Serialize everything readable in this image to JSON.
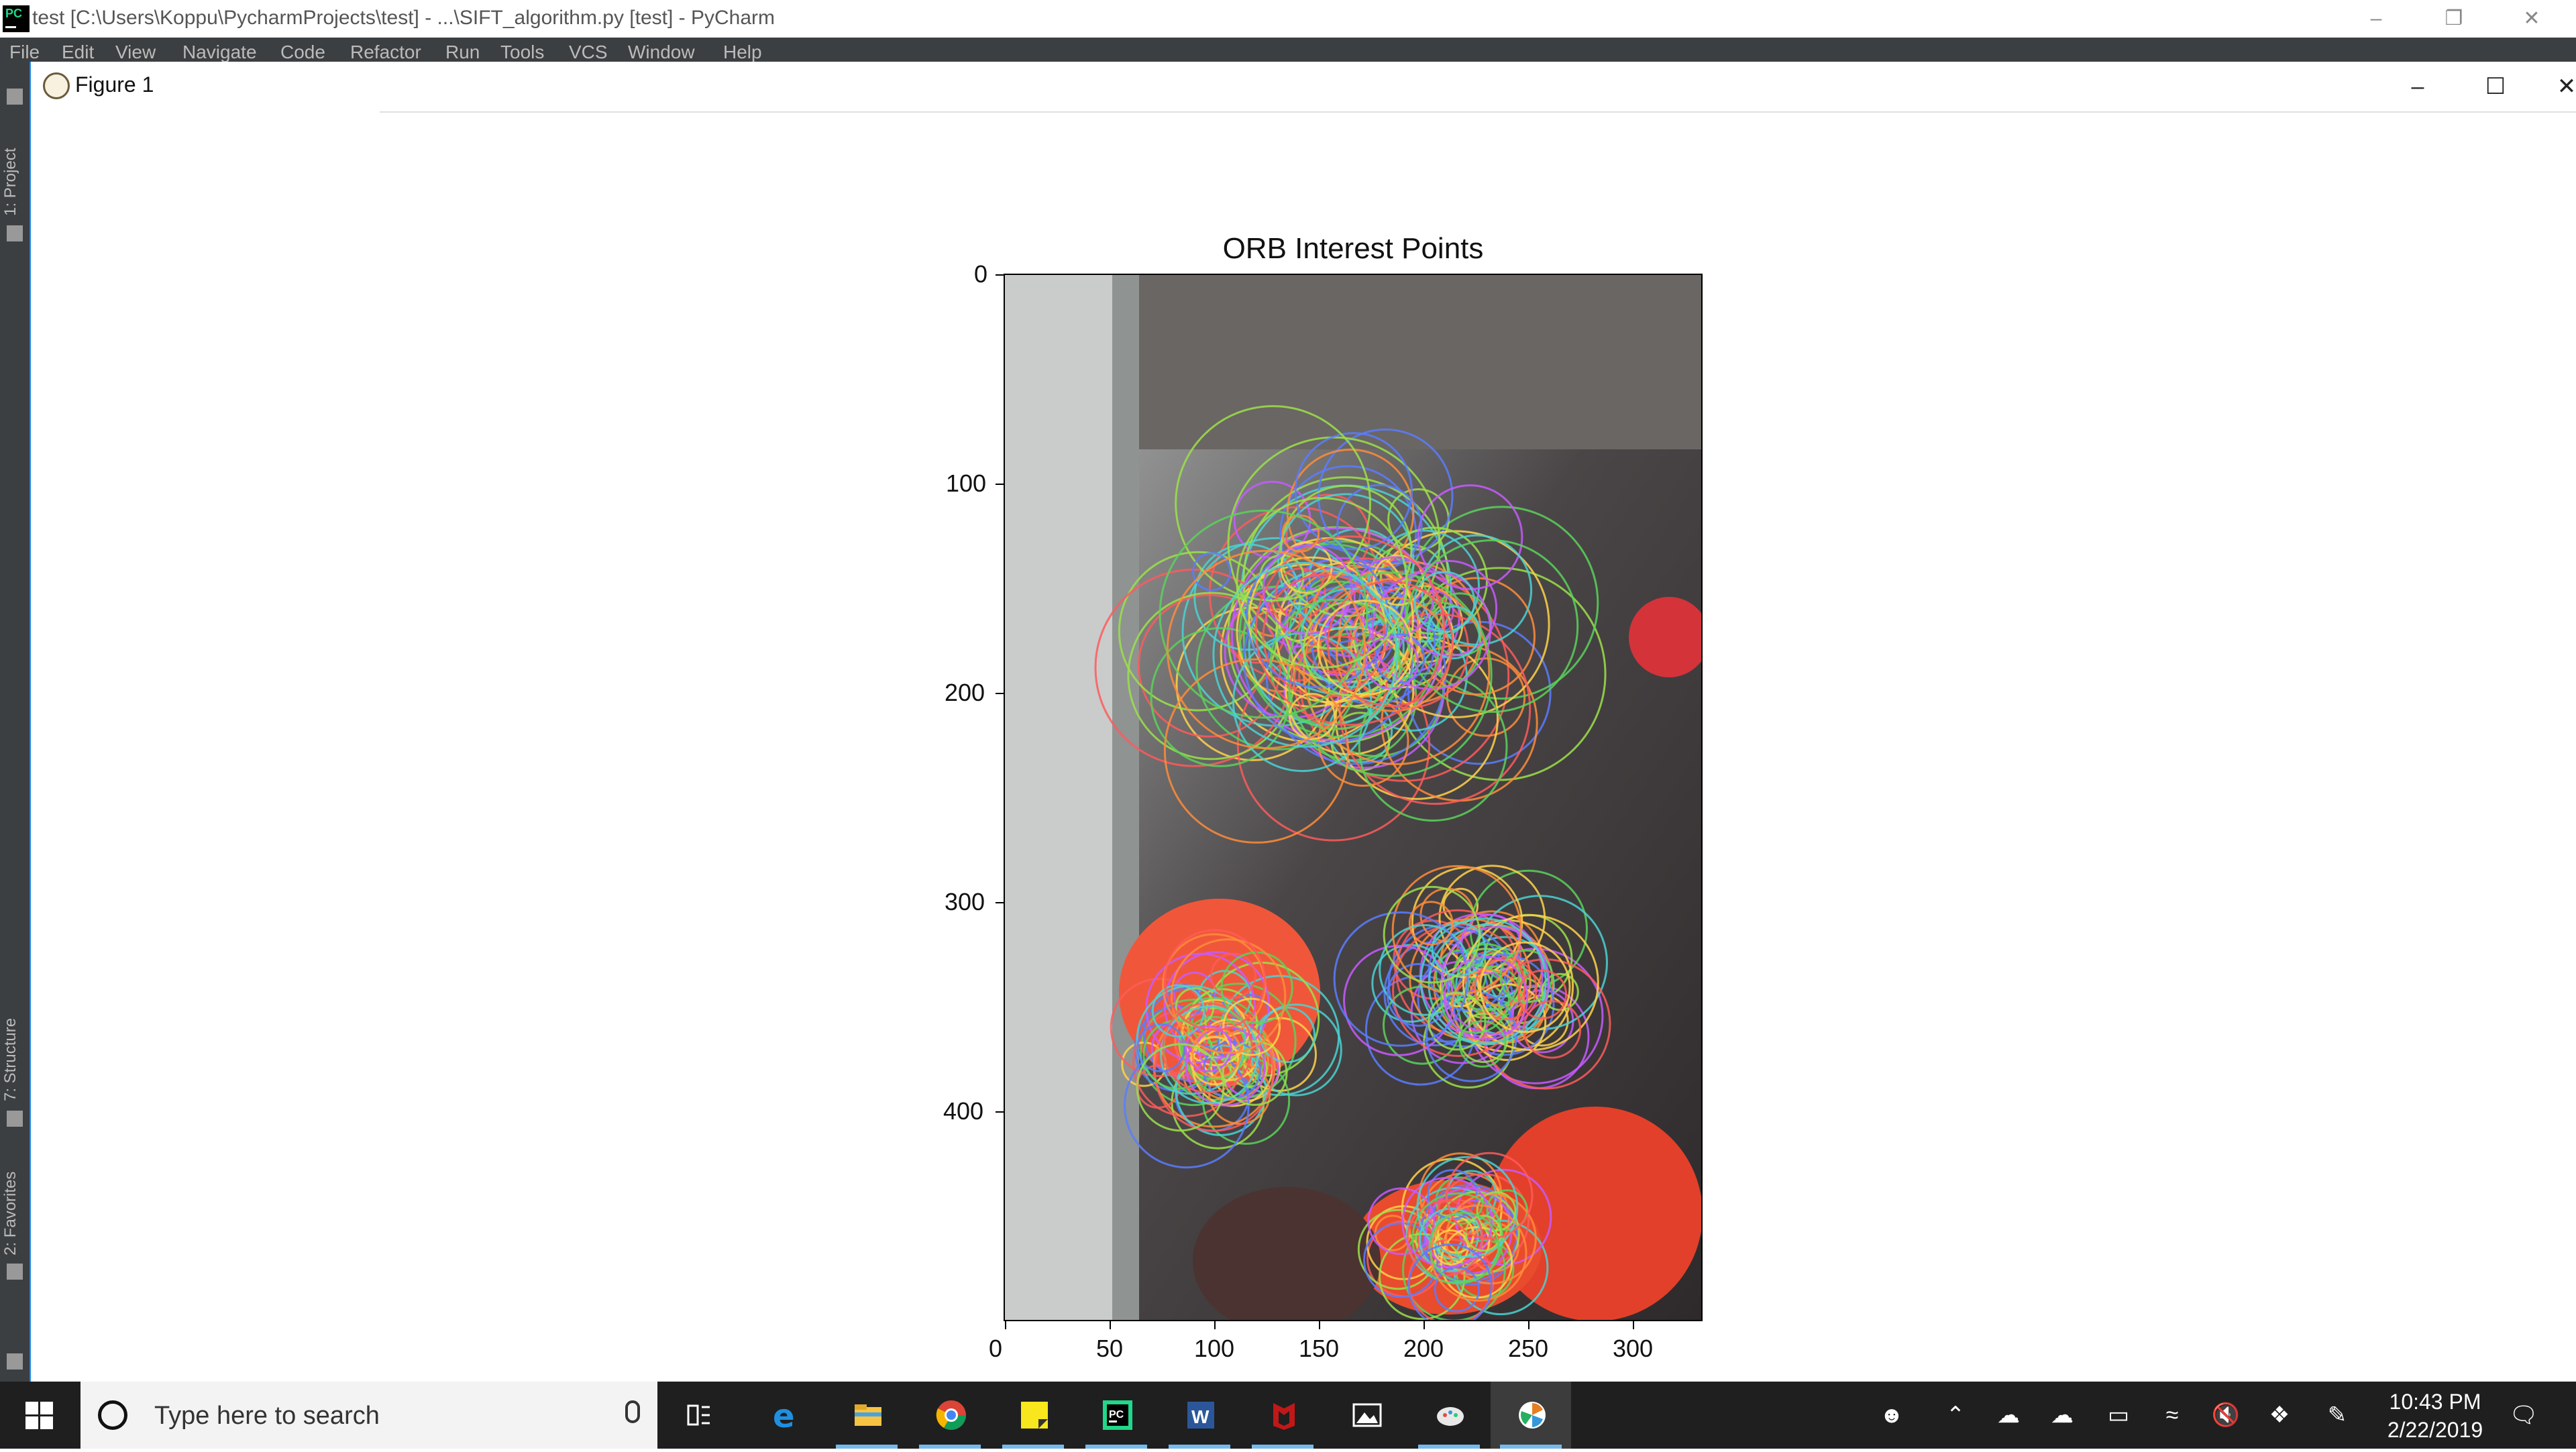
{
  "ide": {
    "title": "test [C:\\Users\\Koppu\\PycharmProjects\\test] - ...\\SIFT_algorithm.py [test] - PyCharm",
    "logo_text": "PC",
    "menu": [
      "File",
      "Edit",
      "View",
      "Navigate",
      "Code",
      "Refactor",
      "Run",
      "Tools",
      "VCS",
      "Window",
      "Help"
    ],
    "side_tabs": [
      "1: Project",
      "7: Structure",
      "2: Favorites"
    ]
  },
  "figure": {
    "window_title": "Figure 1"
  },
  "chart_data": {
    "type": "image",
    "title": "ORB Interest Points",
    "x_ticks": [
      "0",
      "50",
      "100",
      "150",
      "200",
      "250",
      "300"
    ],
    "y_ticks": [
      "0",
      "100",
      "200",
      "300",
      "400"
    ],
    "xlim": [
      0,
      333
    ],
    "ylim": [
      500,
      0
    ],
    "content": "photograph overlaid with colored keypoint circles",
    "keypoint_clusters": [
      {
        "x": 165,
        "y": 170,
        "r": 80
      },
      {
        "x": 100,
        "y": 370,
        "r": 40
      },
      {
        "x": 230,
        "y": 340,
        "r": 45
      },
      {
        "x": 215,
        "y": 460,
        "r": 30
      }
    ],
    "colors": {
      "axis": "#000000",
      "circle_palette": [
        "#ff5a5a",
        "#5ad25a",
        "#5a7dff",
        "#ffd24a",
        "#c85aff",
        "#4ad2d2",
        "#ff8c3a",
        "#9be04a"
      ]
    }
  },
  "taskbar": {
    "search_placeholder": "Type here to search",
    "apps": [
      "task-view",
      "edge",
      "file-explorer",
      "chrome",
      "sticky-notes",
      "pycharm",
      "word",
      "mcafee",
      "photos",
      "paint3d",
      "matplotlib-figure"
    ],
    "time": "10:43 PM",
    "date": "2/22/2019"
  }
}
